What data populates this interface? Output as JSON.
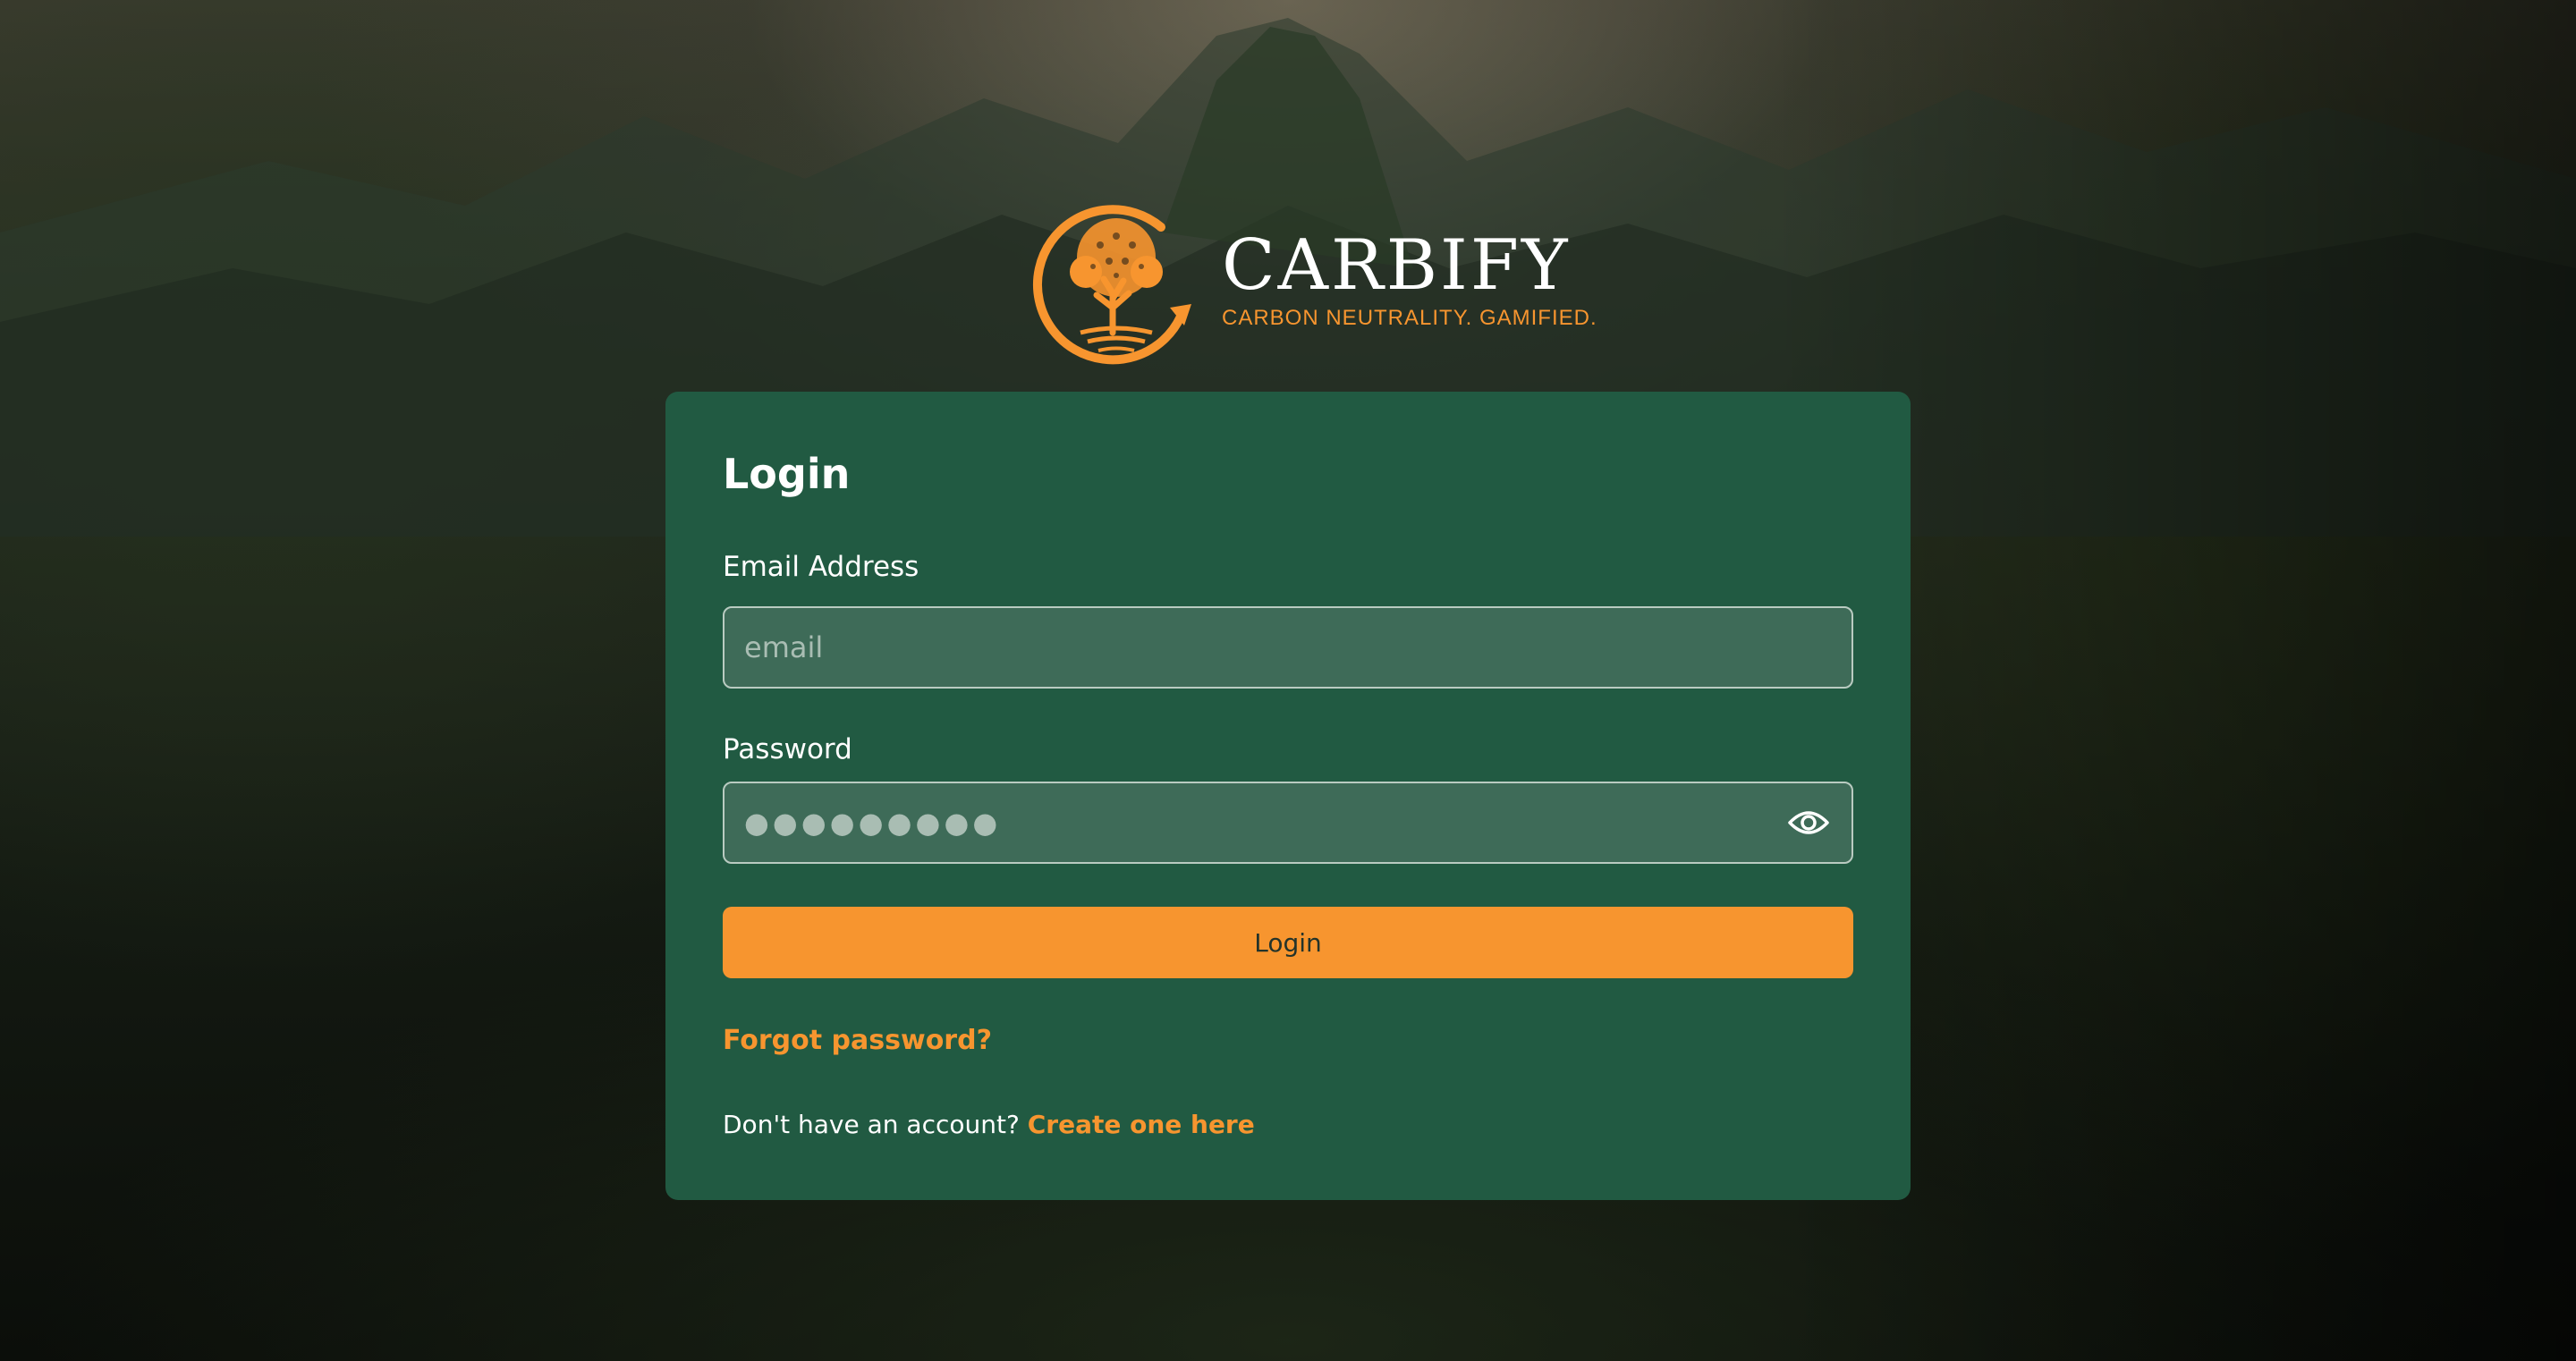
{
  "brand": {
    "name": "CARBIFY",
    "tagline": "CARBON NEUTRALITY. GAMIFIED.",
    "accent_color": "#f7952f",
    "card_color": "#215a42"
  },
  "login_form": {
    "title": "Login",
    "email": {
      "label": "Email Address",
      "placeholder": "email",
      "value": ""
    },
    "password": {
      "label": "Password",
      "placeholder": "●●●●●●●●●",
      "value": "",
      "toggle_icon": "eye-icon"
    },
    "submit_label": "Login",
    "forgot_password_label": "Forgot password?",
    "signup_prompt": "Don't have an account?",
    "signup_link_label": "Create one here"
  }
}
